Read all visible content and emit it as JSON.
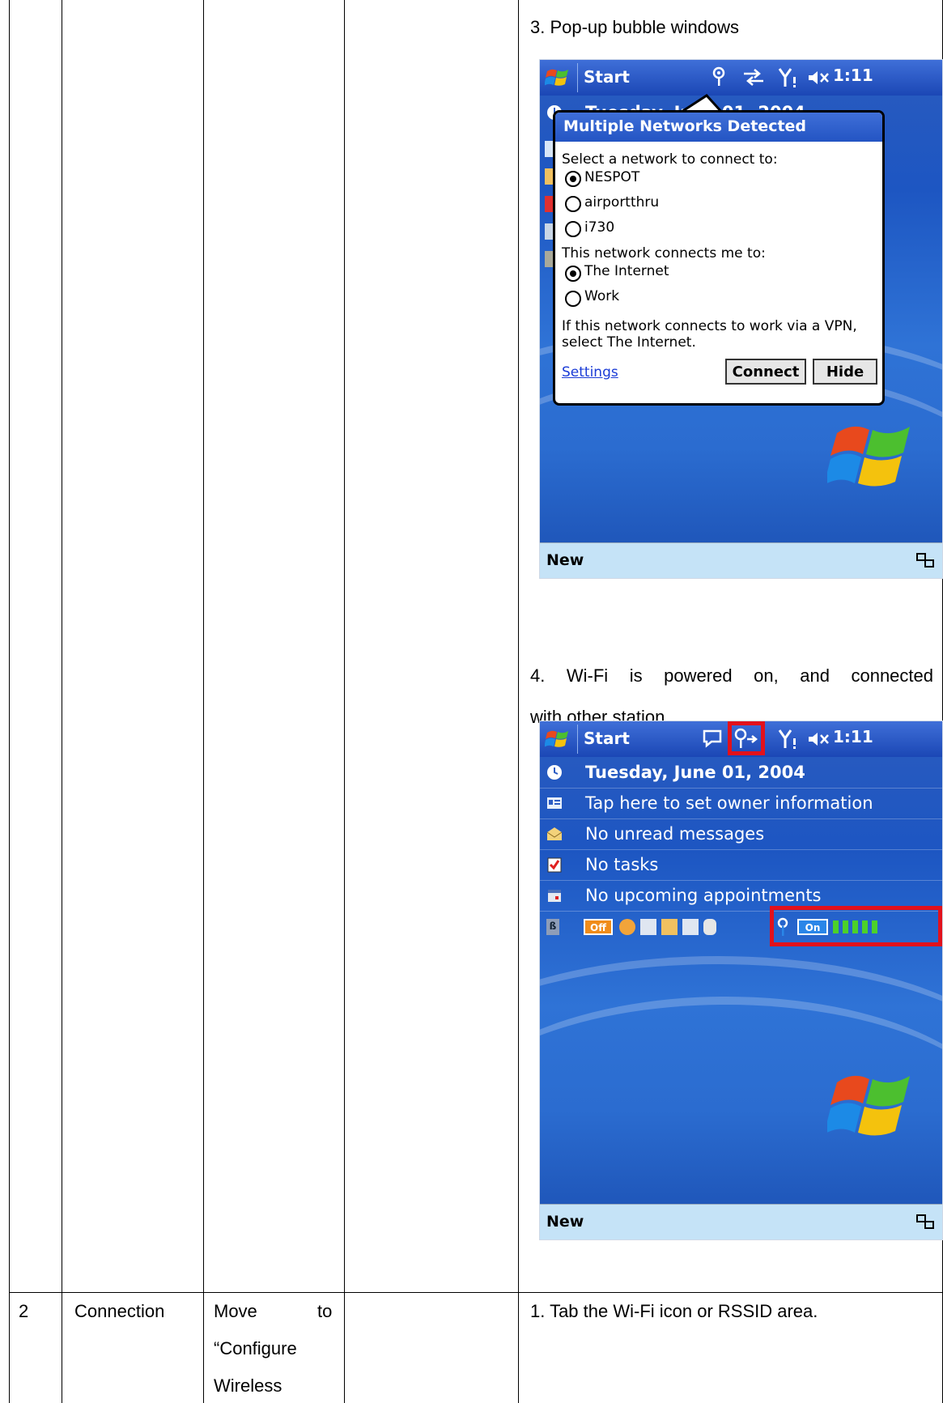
{
  "row1": {
    "step3": {
      "caption": "3. Pop-up bubble windows",
      "screen": {
        "taskbar": {
          "start": "Start",
          "time": "1:11"
        },
        "today_date_partial": "Tuesday, June 01, 2004",
        "bubble": {
          "title": "Multiple Networks Detected",
          "select_label": "Select a network to connect to:",
          "networks": [
            {
              "name": "NESPOT",
              "selected": true
            },
            {
              "name": "airportthru",
              "selected": false
            },
            {
              "name": "i730",
              "selected": false
            }
          ],
          "connects_label": "This network connects me to:",
          "destinations": [
            {
              "name": "The Internet",
              "selected": true
            },
            {
              "name": "Work",
              "selected": false
            }
          ],
          "hint_line1": "If this network connects to work via a VPN,",
          "hint_line2": "select The Internet.",
          "settings_link": "Settings",
          "connect_button": "Connect",
          "hide_button": "Hide"
        },
        "menubar": {
          "new": "New"
        }
      }
    },
    "step4": {
      "caption_line1": "4. Wi-Fi is powered on, and connected",
      "caption_line2": "with other station",
      "screen": {
        "taskbar": {
          "start": "Start",
          "time": "1:11"
        },
        "today_items": [
          "Tuesday, June 01, 2004",
          "Tap here to set owner information",
          "No unread messages",
          "No tasks",
          "No upcoming appointments"
        ],
        "status": {
          "bt_state": "Off",
          "wifi_state": "On",
          "signal_bars": 5
        },
        "menubar": {
          "new": "New"
        }
      }
    }
  },
  "row2": {
    "number": "2",
    "category": "Connection",
    "instruction_line1_a": "Move",
    "instruction_line1_b": "to",
    "instruction_line2": "“Configure",
    "instruction_line3": "Wireless",
    "step1": "1. Tab the Wi-Fi icon or RSSID area."
  }
}
